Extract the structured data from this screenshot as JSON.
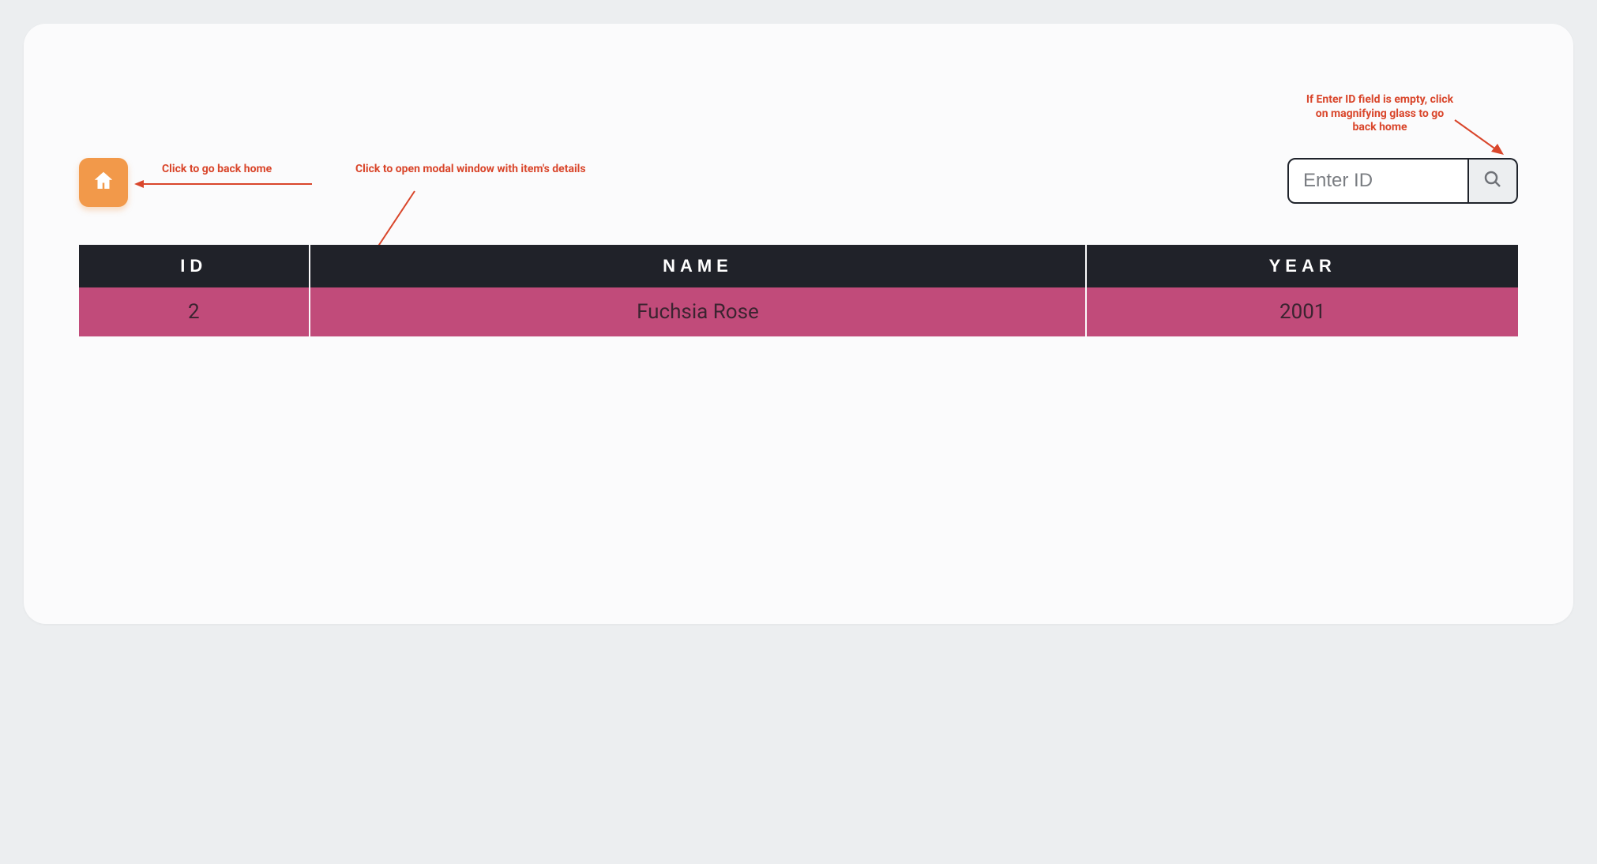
{
  "annotations": {
    "home_hint": "Click to go back home",
    "modal_hint": "Click to open modal window with item's details",
    "search_hint": "If  Enter ID field is empty, click on magnifying glass to go back home"
  },
  "search": {
    "placeholder": "Enter ID",
    "value": ""
  },
  "table": {
    "headers": {
      "id": "ID",
      "name": "NAME",
      "year": "YEAR"
    },
    "rows": [
      {
        "id": "2",
        "name": "Fuchsia Rose",
        "year": "2001"
      }
    ]
  },
  "icons": {
    "home": "home-icon",
    "search": "search-icon"
  },
  "colors": {
    "accent_orange": "#f2994a",
    "row_magenta": "#c14b7a",
    "header_dark": "#202229",
    "annotation_red": "#d9462b"
  }
}
